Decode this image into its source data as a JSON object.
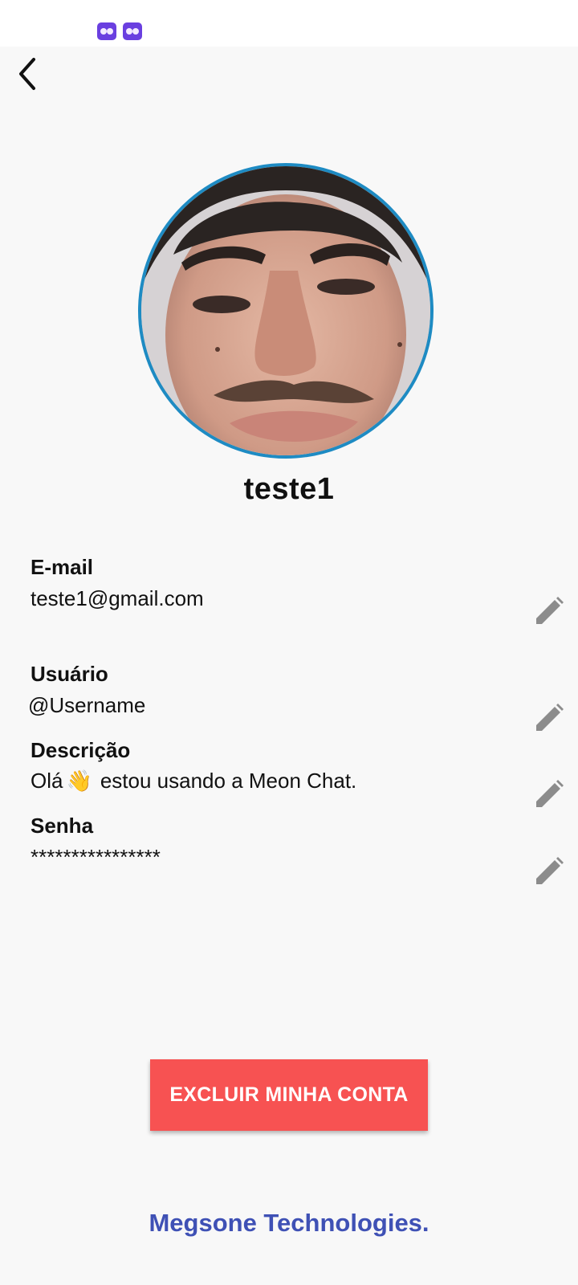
{
  "status_bar": {
    "icons": [
      "meon-notification-icon",
      "meon-notification-icon"
    ],
    "icon_color": "#6a3fe0"
  },
  "header": {
    "back_icon": "chevron-left-icon"
  },
  "profile": {
    "username": "teste1",
    "avatar_border_color": "#1e8bc3"
  },
  "fields": {
    "email": {
      "label": "E-mail",
      "value": "teste1@gmail.com"
    },
    "user": {
      "label": "Usuário",
      "value": "@Username"
    },
    "description": {
      "label": "Descrição",
      "value_before": "Olá",
      "emoji": "👋",
      "value_after": "estou usando a Meon Chat."
    },
    "password": {
      "label": "Senha",
      "value": "****************"
    }
  },
  "actions": {
    "delete_account_label": "EXCLUIR MINHA CONTA",
    "delete_color": "#f75252",
    "edit_icon": "pencil-icon"
  },
  "footer": {
    "brand": "Megsone Technologies.",
    "brand_color": "#3f51b5"
  }
}
